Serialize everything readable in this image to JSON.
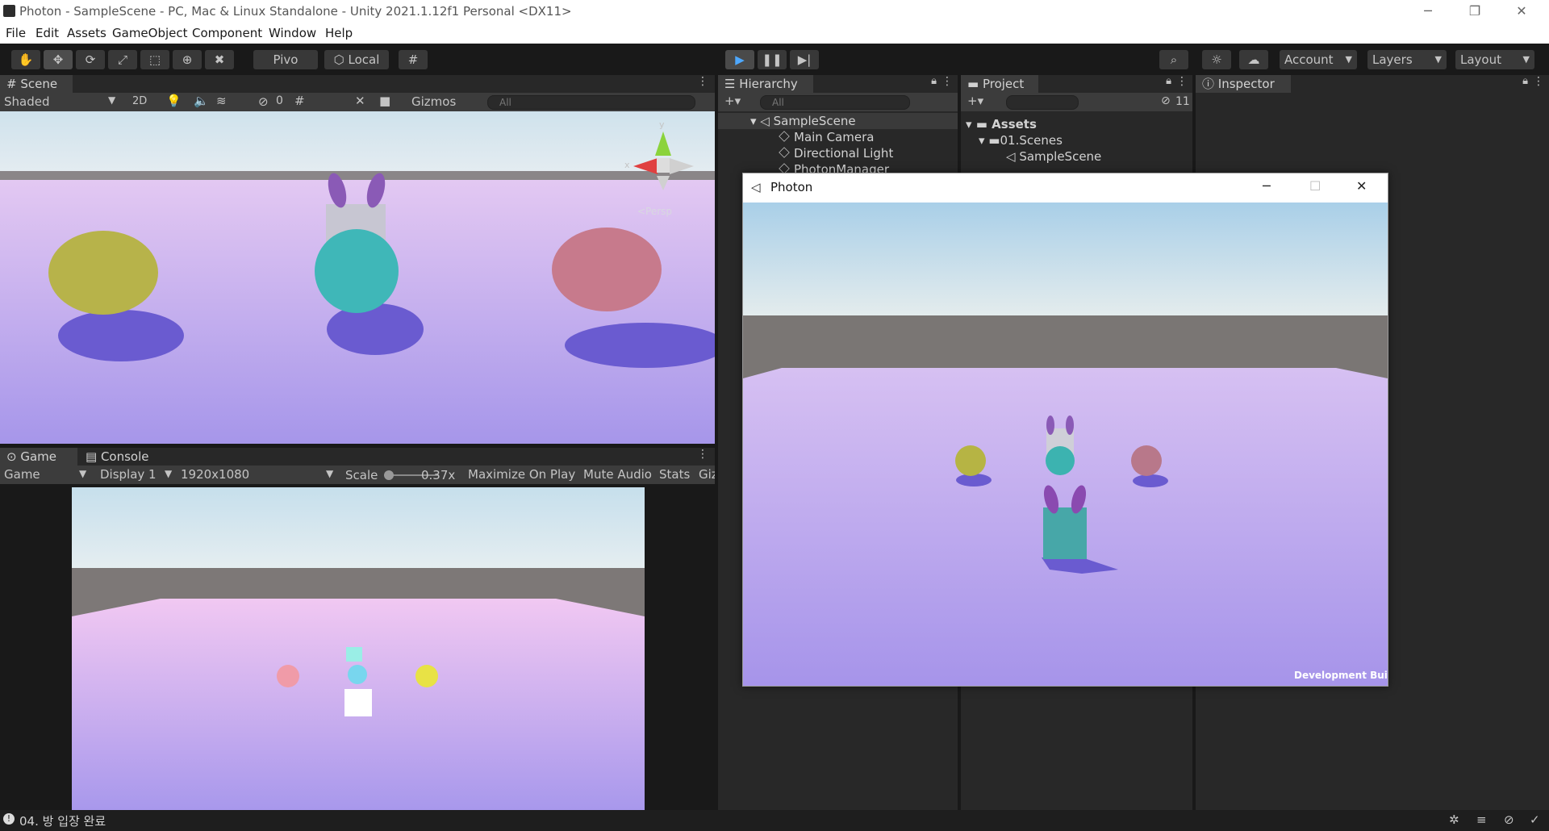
{
  "window": {
    "title": "Photon - SampleScene - PC, Mac & Linux Standalone - Unity 2021.1.12f1 Personal <DX11>",
    "min": "─",
    "max": "❐",
    "close": "✕"
  },
  "menu": [
    "File",
    "Edit",
    "Assets",
    "GameObject",
    "Component",
    "Window",
    "Help"
  ],
  "toolbar": {
    "pivot": "Pivo",
    "local": "Local",
    "account": "Account",
    "layers": "Layers",
    "layout": "Layout"
  },
  "scene": {
    "tab": "Scene",
    "shading": "Shaded",
    "two_d": "2D",
    "hidden_count": "0",
    "gizmos": "Gizmos",
    "search_placeholder": "All",
    "axis_y": "y",
    "axis_x": "x",
    "persp": "<Persp"
  },
  "game": {
    "tab": "Game",
    "console_tab": "Console",
    "mode": "Game",
    "display": "Display 1",
    "resolution": "1920x1080",
    "scale_label": "Scale",
    "scale_value": "0.37x",
    "maximize": "Maximize On Play",
    "mute": "Mute Audio",
    "stats": "Stats",
    "gizmos": "Giz"
  },
  "hierarchy": {
    "tab": "Hierarchy",
    "search_placeholder": "All",
    "scene": "SampleScene",
    "items": [
      "Main Camera",
      "Directional Light",
      "PhotonManager"
    ]
  },
  "project": {
    "tab": "Project",
    "count": "11",
    "root": "Assets",
    "folder": "01.Scenes",
    "scene": "SampleScene"
  },
  "inspector": {
    "tab": "Inspector"
  },
  "photon_window": {
    "title": "Photon",
    "badge": "Development Build"
  },
  "status": {
    "message": "04. 방 입장 완료"
  }
}
